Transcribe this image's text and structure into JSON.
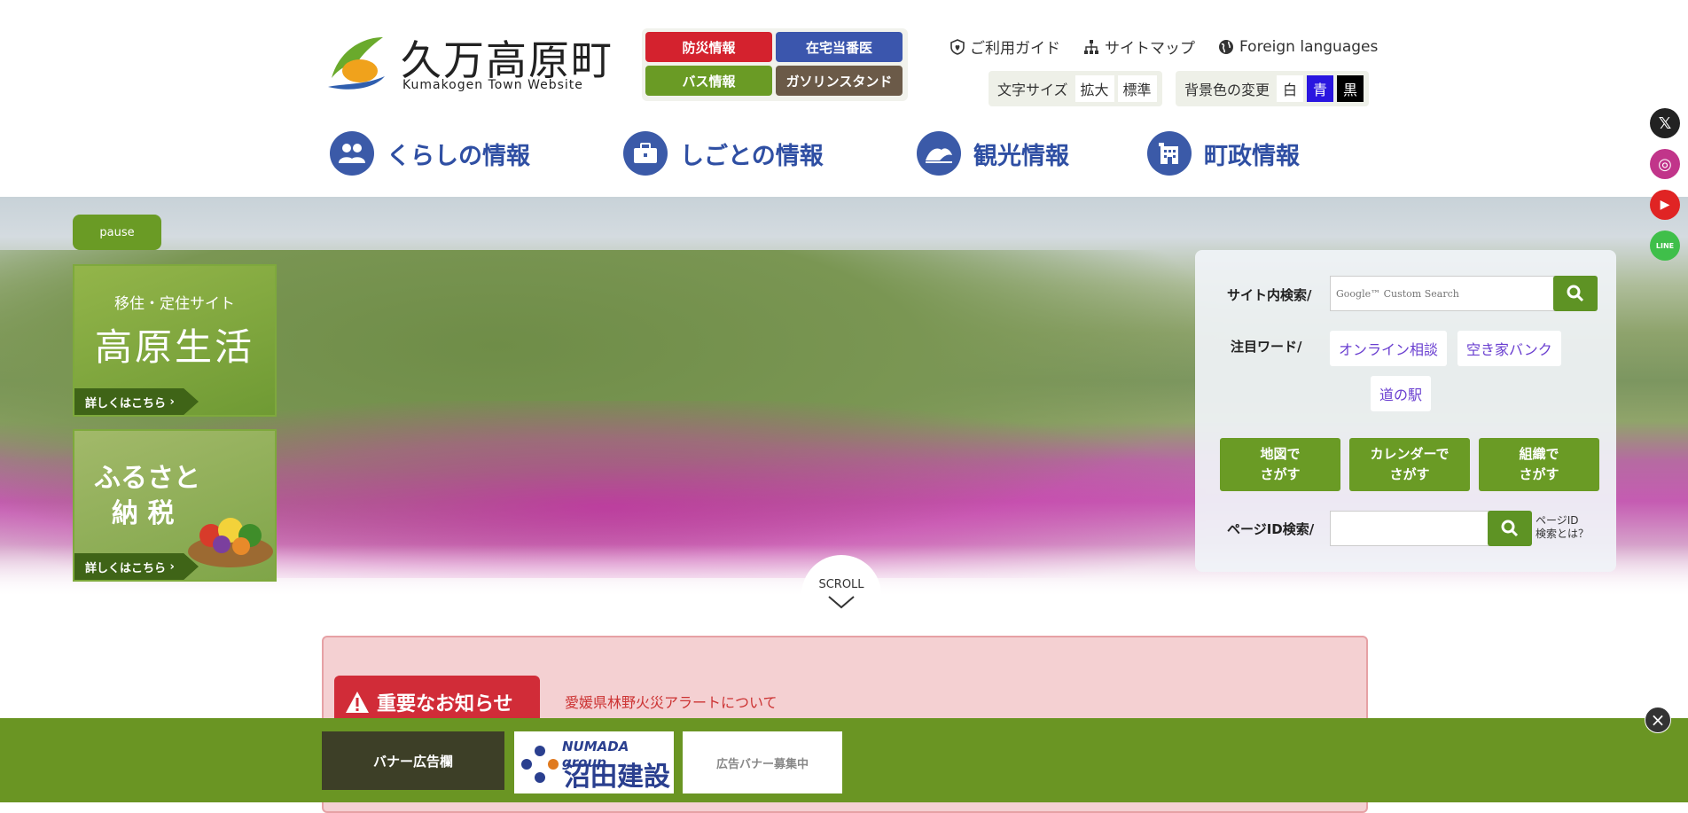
{
  "header": {
    "logo_title": "久万高原町",
    "logo_subtitle": "Kumakogen Town Website",
    "quick_links": [
      {
        "label": "防災情報",
        "color": "#d4222e"
      },
      {
        "label": "在宅当番医",
        "color": "#3b56ad"
      },
      {
        "label": "バス情報",
        "color": "#6a9b25"
      },
      {
        "label": "ガソリンスタンド",
        "color": "#6b5a48"
      }
    ],
    "top_links": [
      {
        "label": "ご利用ガイド",
        "icon": "shield-heart-icon"
      },
      {
        "label": "サイトマップ",
        "icon": "sitemap-icon"
      },
      {
        "label": "Foreign languages",
        "icon": "globe-icon"
      }
    ],
    "font_size": {
      "label": "文字サイズ",
      "enlarge": "拡大",
      "standard": "標準"
    },
    "bg_color": {
      "label": "背景色の変更",
      "white": "白",
      "blue": "青",
      "black": "黒"
    },
    "main_nav": [
      {
        "label": "くらしの情報",
        "icon": "people-icon"
      },
      {
        "label": "しごとの情報",
        "icon": "briefcase-icon"
      },
      {
        "label": "観光情報",
        "icon": "landscape-icon"
      },
      {
        "label": "町政情報",
        "icon": "building-icon"
      }
    ]
  },
  "hero": {
    "pause_label": "pause",
    "promos": [
      {
        "title_small": "移住・定住サイト",
        "title_big": "高原生活",
        "more": "詳しくはこちら"
      },
      {
        "title_line1": "ふるさと",
        "title_line2": "納 税",
        "more": "詳しくはこちら"
      }
    ],
    "scroll_label": "SCROLL"
  },
  "search": {
    "site_search_label": "サイト内検索/",
    "site_search_placeholder": "Google™ Custom Search",
    "featured_label": "注目ワード/",
    "featured_words": [
      "オンライン相談",
      "空き家バンク",
      "道の駅"
    ],
    "find_buttons": [
      {
        "line1": "地図で",
        "line2": "さがす"
      },
      {
        "line1": "カレンダーで",
        "line2": "さがす"
      },
      {
        "line1": "組織で",
        "line2": "さがす"
      }
    ],
    "page_id_label": "ページID検索/",
    "page_id_help_line1": "ページID",
    "page_id_help_line2": "検索とは？"
  },
  "notice": {
    "badge": "重要なお知らせ",
    "link": "愛媛県林野火災アラートについて"
  },
  "banner": {
    "label": "バナー広告欄",
    "sponsor1_top": "NUMADA group",
    "sponsor1_main": "沼田建設",
    "sponsor2": "広告バナー募集中",
    "close": "×"
  },
  "social": [
    {
      "name": "x-icon",
      "color": "#222",
      "glyph": "𝕏"
    },
    {
      "name": "instagram-icon",
      "color": "#c1358a",
      "glyph": "◎"
    },
    {
      "name": "youtube-icon",
      "color": "#e02424",
      "glyph": "▶"
    },
    {
      "name": "line-icon",
      "color": "#3fbf4a",
      "glyph": "LINE"
    }
  ]
}
